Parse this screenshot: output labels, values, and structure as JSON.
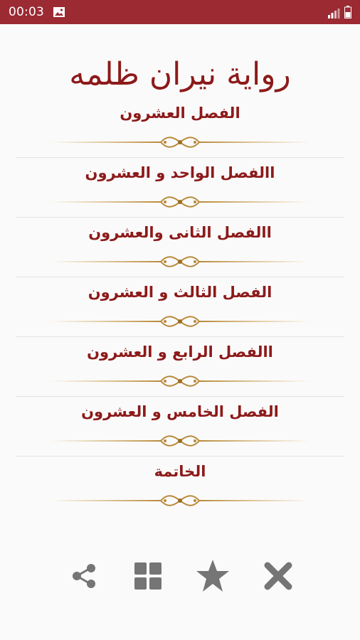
{
  "status_bar": {
    "time": "00:03",
    "icons": [
      "image-icon",
      "signal-icon",
      "battery-icon"
    ],
    "background_color": "#9b2a33"
  },
  "page": {
    "title": "رواية نيران ظلمه",
    "title_color": "#8c1a1a",
    "ornament_color": "#c9a24a"
  },
  "chapters": [
    {
      "label": "الفصل العشرون"
    },
    {
      "label": "االفصل الواحد و العشرون"
    },
    {
      "label": "االفصل الثانى والعشرون"
    },
    {
      "label": "الفصل الثالث و العشرون"
    },
    {
      "label": "االفصل الرابع و العشرون"
    },
    {
      "label": "الفصل الخامس و العشرون"
    },
    {
      "label": "الخاتمة"
    }
  ],
  "toolbar": {
    "buttons": [
      {
        "icon": "share-icon"
      },
      {
        "icon": "grid-icon"
      },
      {
        "icon": "star-icon"
      },
      {
        "icon": "close-icon"
      }
    ],
    "icon_color": "#757575"
  }
}
